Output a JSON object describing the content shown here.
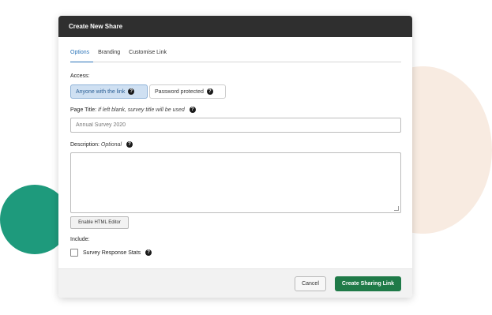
{
  "modal": {
    "title": "Create New Share",
    "tabs": [
      {
        "label": "Options",
        "active": true
      },
      {
        "label": "Branding",
        "active": false
      },
      {
        "label": "Customise Link",
        "active": false
      }
    ],
    "access": {
      "label": "Access:",
      "options": [
        {
          "label": "Anyone with the link",
          "selected": true
        },
        {
          "label": "Password protected",
          "selected": false
        }
      ]
    },
    "page_title": {
      "label": "Page Title:",
      "hint": "If left blank, survey title will be used",
      "placeholder": "Annual Survey 2020",
      "value": ""
    },
    "description": {
      "label": "Description:",
      "hint": "Optional",
      "value": ""
    },
    "enable_html_editor": "Enable HTML Editor",
    "include": {
      "label": "Include:",
      "survey_response_stats": {
        "label": "Survey Response Stats",
        "checked": false
      }
    },
    "footer": {
      "cancel": "Cancel",
      "create": "Create Sharing Link"
    }
  },
  "colors": {
    "header_bg": "#2f2f2f",
    "accent": "#2a73b8",
    "primary_button": "#1f7a48",
    "decor_peach": "#f8ebe1",
    "decor_green": "#1e9a7c"
  }
}
